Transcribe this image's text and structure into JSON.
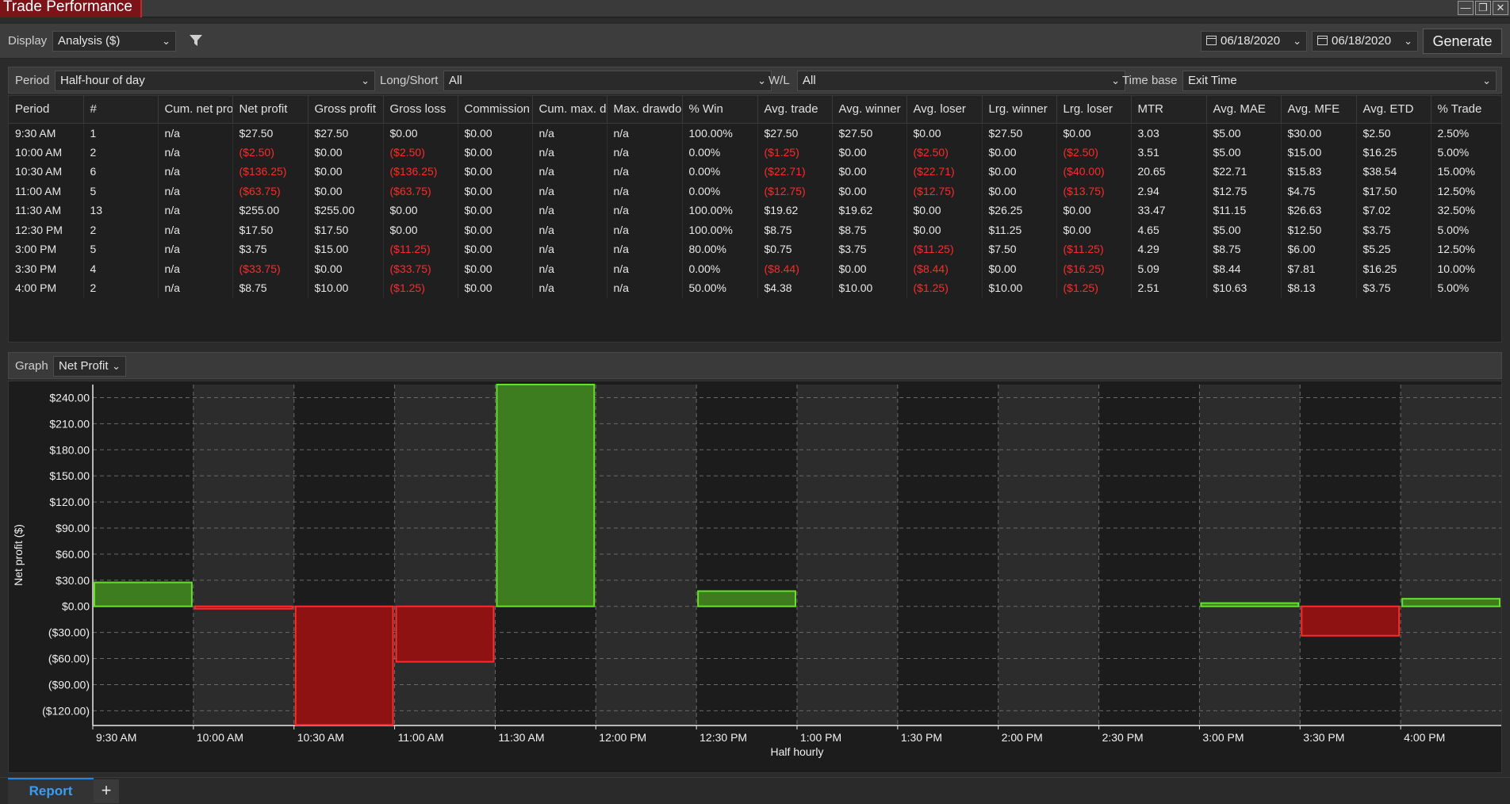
{
  "window": {
    "title": "Trade Performance",
    "minimize": "—",
    "restore": "❐",
    "close": "✕"
  },
  "toolbar": {
    "display_label": "Display",
    "display_value": "Analysis ($)",
    "date_from": "06/18/2020",
    "date_to": "06/18/2020",
    "generate_label": "Generate"
  },
  "params": {
    "period_label": "Period",
    "period_value": "Half-hour of day",
    "longshort_label": "Long/Short",
    "longshort_value": "All",
    "wl_label": "W/L",
    "wl_value": "All",
    "timebase_label": "Time base",
    "timebase_value": "Exit Time"
  },
  "table": {
    "columns": [
      "Period",
      "#",
      "Cum. net pro",
      "Net profit",
      "Gross profit",
      "Gross loss",
      "Commission",
      "Cum. max. d",
      "Max. drawdo",
      "% Win",
      "Avg. trade",
      "Avg. winner",
      "Avg. loser",
      "Lrg. winner",
      "Lrg. loser",
      "MTR",
      "Avg. MAE",
      "Avg. MFE",
      "Avg. ETD",
      "% Trade"
    ],
    "rows": [
      [
        "9:30 AM",
        "1",
        "n/a",
        "$27.50",
        "$27.50",
        "$0.00",
        "$0.00",
        "n/a",
        "n/a",
        "100.00%",
        "$27.50",
        "$27.50",
        "$0.00",
        "$27.50",
        "$0.00",
        "3.03",
        "$5.00",
        "$30.00",
        "$2.50",
        "2.50%"
      ],
      [
        "10:00 AM",
        "2",
        "n/a",
        "($2.50)",
        "$0.00",
        "($2.50)",
        "$0.00",
        "n/a",
        "n/a",
        "0.00%",
        "($1.25)",
        "$0.00",
        "($2.50)",
        "$0.00",
        "($2.50)",
        "3.51",
        "$5.00",
        "$15.00",
        "$16.25",
        "5.00%"
      ],
      [
        "10:30 AM",
        "6",
        "n/a",
        "($136.25)",
        "$0.00",
        "($136.25)",
        "$0.00",
        "n/a",
        "n/a",
        "0.00%",
        "($22.71)",
        "$0.00",
        "($22.71)",
        "$0.00",
        "($40.00)",
        "20.65",
        "$22.71",
        "$15.83",
        "$38.54",
        "15.00%"
      ],
      [
        "11:00 AM",
        "5",
        "n/a",
        "($63.75)",
        "$0.00",
        "($63.75)",
        "$0.00",
        "n/a",
        "n/a",
        "0.00%",
        "($12.75)",
        "$0.00",
        "($12.75)",
        "$0.00",
        "($13.75)",
        "2.94",
        "$12.75",
        "$4.75",
        "$17.50",
        "12.50%"
      ],
      [
        "11:30 AM",
        "13",
        "n/a",
        "$255.00",
        "$255.00",
        "$0.00",
        "$0.00",
        "n/a",
        "n/a",
        "100.00%",
        "$19.62",
        "$19.62",
        "$0.00",
        "$26.25",
        "$0.00",
        "33.47",
        "$11.15",
        "$26.63",
        "$7.02",
        "32.50%"
      ],
      [
        "12:30 PM",
        "2",
        "n/a",
        "$17.50",
        "$17.50",
        "$0.00",
        "$0.00",
        "n/a",
        "n/a",
        "100.00%",
        "$8.75",
        "$8.75",
        "$0.00",
        "$11.25",
        "$0.00",
        "4.65",
        "$5.00",
        "$12.50",
        "$3.75",
        "5.00%"
      ],
      [
        "3:00 PM",
        "5",
        "n/a",
        "$3.75",
        "$15.00",
        "($11.25)",
        "$0.00",
        "n/a",
        "n/a",
        "80.00%",
        "$0.75",
        "$3.75",
        "($11.25)",
        "$7.50",
        "($11.25)",
        "4.29",
        "$8.75",
        "$6.00",
        "$5.25",
        "12.50%"
      ],
      [
        "3:30 PM",
        "4",
        "n/a",
        "($33.75)",
        "$0.00",
        "($33.75)",
        "$0.00",
        "n/a",
        "n/a",
        "0.00%",
        "($8.44)",
        "$0.00",
        "($8.44)",
        "$0.00",
        "($16.25)",
        "5.09",
        "$8.44",
        "$7.81",
        "$16.25",
        "10.00%"
      ],
      [
        "4:00 PM",
        "2",
        "n/a",
        "$8.75",
        "$10.00",
        "($1.25)",
        "$0.00",
        "n/a",
        "n/a",
        "50.00%",
        "$4.38",
        "$10.00",
        "($1.25)",
        "$10.00",
        "($1.25)",
        "2.51",
        "$10.63",
        "$8.13",
        "$3.75",
        "5.00%"
      ]
    ]
  },
  "graph": {
    "label": "Graph",
    "value": "Net Profit"
  },
  "chart_data": {
    "type": "bar",
    "categories": [
      "9:30 AM",
      "10:00 AM",
      "10:30 AM",
      "11:00 AM",
      "11:30 AM",
      "12:00 PM",
      "12:30 PM",
      "1:00 PM",
      "1:30 PM",
      "2:00 PM",
      "2:30 PM",
      "3:00 PM",
      "3:30 PM",
      "4:00 PM"
    ],
    "values": [
      27.5,
      -2.5,
      -136.25,
      -63.75,
      255.0,
      null,
      17.5,
      null,
      null,
      null,
      null,
      3.75,
      -33.75,
      8.75
    ],
    "xlabel": "Half hourly",
    "ylabel": "Net profit ($)",
    "ylim": [
      -137,
      255
    ],
    "yticks": [
      240,
      210,
      180,
      150,
      120,
      90,
      60,
      30,
      0,
      -30,
      -60,
      -90,
      -120
    ],
    "ytick_labels": [
      "$240.00",
      "$210.00",
      "$180.00",
      "$150.00",
      "$120.00",
      "$90.00",
      "$60.00",
      "$30.00",
      "$0.00",
      "($30.00)",
      "($60.00)",
      "($90.00)",
      "($120.00)"
    ],
    "grid": true,
    "colors": {
      "positive_fill": "#3d7d1f",
      "positive_edge": "#66e02a",
      "negative_fill": "#8e1212",
      "negative_edge": "#ff2a2a",
      "band_dark": "#1c1c1c",
      "band_light": "#2c2c2c"
    }
  },
  "bottom": {
    "tab_report": "Report",
    "tab_add": "+"
  }
}
